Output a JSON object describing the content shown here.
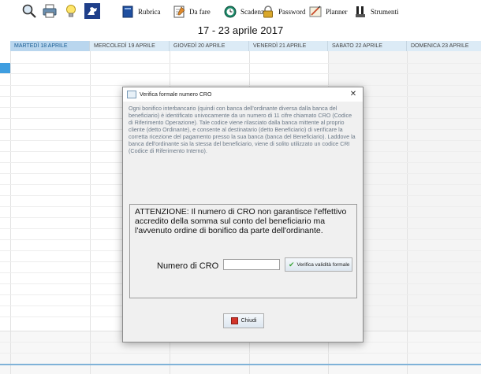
{
  "toolbar": {
    "icons": [
      "search-icon",
      "printer-icon",
      "lightbulb-icon",
      "horse-logo-icon"
    ],
    "buttons": [
      {
        "label": "Rubrica",
        "icon": "book-icon"
      },
      {
        "label": "Da fare",
        "icon": "notepad-icon"
      },
      {
        "label": "Scadenze",
        "icon": "clock-icon"
      },
      {
        "label": "Password",
        "icon": "padlock-icon"
      },
      {
        "label": "Planner",
        "icon": "planner-icon"
      },
      {
        "label": "Strumenti",
        "icon": "tools-icon"
      }
    ]
  },
  "week_title": "17 - 23 aprile 2017",
  "days": [
    "MARTEDÌ 18 APRILE",
    "MERCOLEDÌ 19 APRILE",
    "GIOVEDÌ 20 APRILE",
    "VENERDÌ 21 APRILE",
    "SABATO 22 APRILE",
    "DOMENICA 23 APRILE"
  ],
  "dialog": {
    "title": "Verifica formale numero CRO",
    "close_glyph": "✕",
    "intro": "Ogni bonifico interbancario (quindi con banca dell'ordinante diversa dalla banca del beneficiario) è identificato univocamente da un numero di 11 cifre chiamato CRO (Codice di Riferimento Operazione). Tale codice viene rilasciato dalla banca mittente al proprio cliente (detto Ordinante), e consente al destinatario (detto Beneficiario) di verificare la corretta ricezione del pagamento presso la sua banca (banca del Beneficiario). Laddove la banca dell'ordinante sia la stessa del beneficiario, viene di solito utilizzato un codice CRI (Codice di Riferimento Interno).",
    "warning": "ATTENZIONE: Il numero di CRO non garantisce l'effettivo accredito della somma sul conto del beneficiario ma l'avvenuto ordine di bonifico da parte dell'ordinante.",
    "cro_label": "Numero di CRO",
    "cro_value": "",
    "verify_label": "Verifica validità formale",
    "close_label": "Chiudi"
  },
  "colors": {
    "accent": "#3f9ee0",
    "header_bg": "#dcebf6",
    "active_header": "#b9d6ee",
    "close_button_square": "#d2352b"
  }
}
